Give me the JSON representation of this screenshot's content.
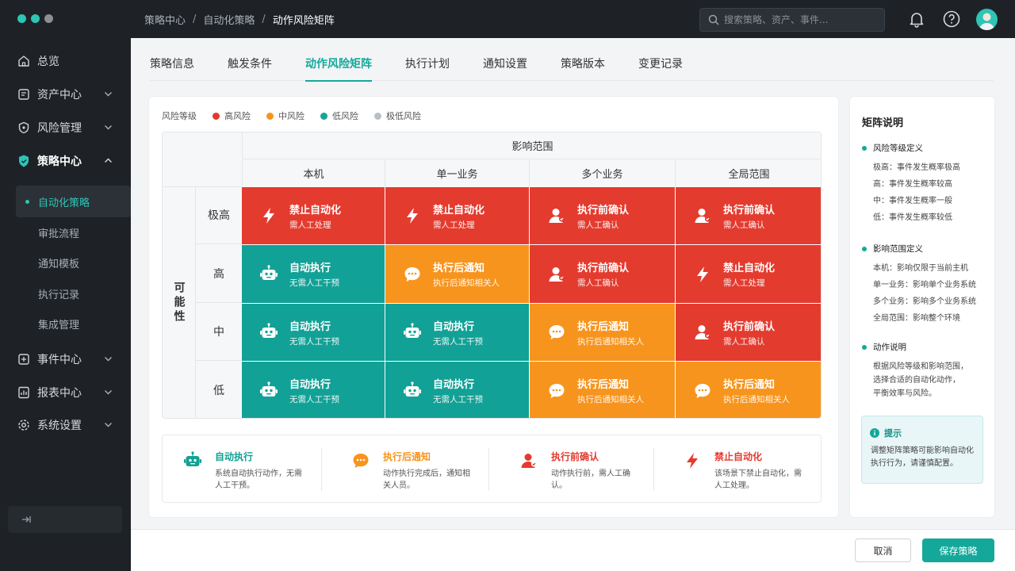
{
  "breadcrumb": {
    "items": [
      "策略中心",
      "自动化策略",
      "动作风险矩阵"
    ],
    "sep": "/"
  },
  "search": {
    "placeholder": "搜索策略、资产、事件..."
  },
  "sidebar": {
    "items": [
      {
        "label": "总览",
        "icon": "home-icon"
      },
      {
        "label": "资产中心",
        "icon": "asset-icon"
      },
      {
        "label": "风险管理",
        "icon": "risk-icon"
      },
      {
        "label": "策略中心",
        "icon": "shield-icon"
      },
      {
        "label": "事件中心",
        "icon": "event-icon"
      },
      {
        "label": "报表中心",
        "icon": "report-icon"
      },
      {
        "label": "系统设置",
        "icon": "gear-icon"
      }
    ],
    "sub_items": [
      "自动化策略",
      "审批流程",
      "通知模板",
      "执行记录",
      "集成管理"
    ]
  },
  "tabs": [
    "策略信息",
    "触发条件",
    "动作风险矩阵",
    "执行计划",
    "通知设置",
    "策略版本",
    "变更记录"
  ],
  "legend": {
    "title": "风险等级",
    "items": [
      {
        "label": "高风险",
        "color": "#e23a2e"
      },
      {
        "label": "中风险",
        "color": "#f7941d"
      },
      {
        "label": "低风险",
        "color": "#17a398"
      },
      {
        "label": "极低风险",
        "color": "#b7c0c7"
      }
    ]
  },
  "matrix": {
    "scope_title": "影响范围",
    "possibility_title": "可能性",
    "columns": [
      "本机",
      "单一业务",
      "多个业务",
      "全局范围"
    ],
    "rows": [
      "极高",
      "高",
      "中",
      "低"
    ],
    "cells": [
      [
        {
          "a": "ban",
          "title": "禁止自动化",
          "sub": "需人工处理"
        },
        {
          "a": "ban",
          "title": "禁止自动化",
          "sub": "需人工处理"
        },
        {
          "a": "confirm",
          "title": "执行前确认",
          "sub": "需人工确认"
        },
        {
          "a": "confirm",
          "title": "执行前确认",
          "sub": "需人工确认"
        }
      ],
      [
        {
          "a": "auto",
          "title": "自动执行",
          "sub": "无需人工干预"
        },
        {
          "a": "notify",
          "title": "执行后通知",
          "sub": "执行后通知相关人"
        },
        {
          "a": "confirm",
          "title": "执行前确认",
          "sub": "需人工确认"
        },
        {
          "a": "ban",
          "title": "禁止自动化",
          "sub": "需人工处理"
        }
      ],
      [
        {
          "a": "auto",
          "title": "自动执行",
          "sub": "无需人工干预"
        },
        {
          "a": "auto",
          "title": "自动执行",
          "sub": "无需人工干预"
        },
        {
          "a": "notify",
          "title": "执行后通知",
          "sub": "执行后通知相关人"
        },
        {
          "a": "confirm",
          "title": "执行前确认",
          "sub": "需人工确认"
        }
      ],
      [
        {
          "a": "auto",
          "title": "自动执行",
          "sub": "无需人工干预"
        },
        {
          "a": "auto",
          "title": "自动执行",
          "sub": "无需人工干预"
        },
        {
          "a": "auto",
          "title": "执行后通知",
          "sub": "执行后通知相关人"
        },
        {
          "a": "notify",
          "title": "执行后通知",
          "sub": "执行后通知相关人"
        }
      ]
    ],
    "cell_colors": {
      "ban": "#e43b2f",
      "confirm": "#e43b2f",
      "auto": "#12a196",
      "notify": "#f7941d"
    }
  },
  "actions": [
    {
      "key": "auto",
      "title": "自动执行",
      "desc": "系统自动执行动作，无需人工干预。",
      "color": "#12a196",
      "icon": "robot-icon"
    },
    {
      "key": "notify",
      "title": "执行后通知",
      "desc": "动作执行完成后，通知相关人员。",
      "color": "#f7941d",
      "icon": "chat-icon"
    },
    {
      "key": "confirm",
      "title": "执行前确认",
      "desc": "动作执行前，需人工确认。",
      "color": "#e43b2f",
      "icon": "user-icon"
    },
    {
      "key": "ban",
      "title": "禁止自动化",
      "desc": "该场景下禁止自动化，需人工处理。",
      "color": "#e43b2f",
      "icon": "bolt-icon"
    }
  ],
  "panel": {
    "title": "矩阵说明",
    "sec1": {
      "title": "风险等级定义",
      "lines": [
        "极高：事件发生概率极高",
        "高：事件发生概率较高",
        "中：事件发生概率一般",
        "低：事件发生概率较低"
      ]
    },
    "sec2": {
      "title": "影响范围定义",
      "lines": [
        "本机：影响仅限于当前主机",
        "单一业务：影响单个业务系统",
        "多个业务：影响多个业务系统",
        "全局范围：影响整个环境"
      ]
    },
    "sec3": {
      "title": "动作说明",
      "lines": [
        "根据风险等级和影响范围，",
        "选择合适的自动化动作，",
        "平衡效率与风险。"
      ]
    },
    "tip": {
      "title": "提示",
      "text": "调整矩阵策略可能影响自动化执行行为，请谨慎配置。"
    }
  },
  "footer": {
    "cancel": "取消",
    "save": "保存策略"
  }
}
